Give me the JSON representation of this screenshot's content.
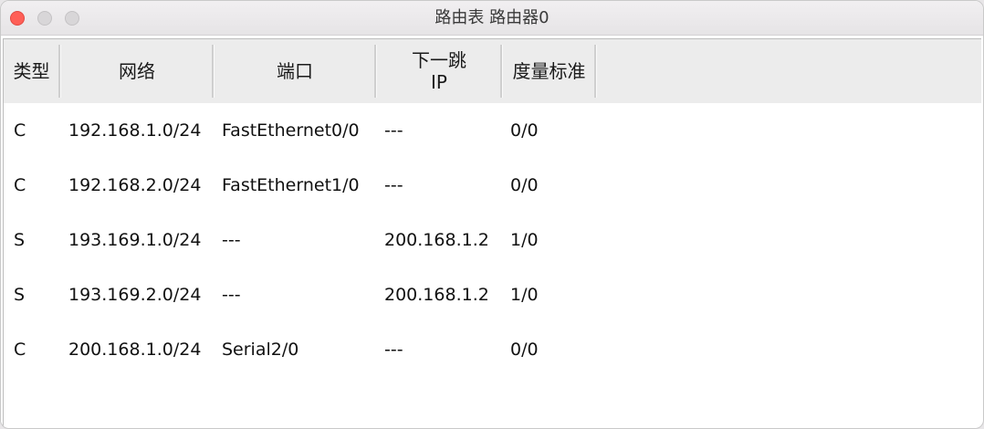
{
  "window": {
    "title": "路由表 路由器0"
  },
  "table": {
    "columns": [
      {
        "key": "type",
        "label": "类型"
      },
      {
        "key": "network",
        "label": "网络"
      },
      {
        "key": "port",
        "label": "端口"
      },
      {
        "key": "next_hop_line1",
        "label": "下一跳"
      },
      {
        "key": "next_hop_line2",
        "label": "IP"
      },
      {
        "key": "metric",
        "label": "度量标准"
      }
    ],
    "rows": [
      {
        "type": "C",
        "network": "192.168.1.0/24",
        "port": "FastEthernet0/0",
        "next_hop": "---",
        "metric": "0/0"
      },
      {
        "type": "C",
        "network": "192.168.2.0/24",
        "port": "FastEthernet1/0",
        "next_hop": "---",
        "metric": "0/0"
      },
      {
        "type": "S",
        "network": "193.169.1.0/24",
        "port": "---",
        "next_hop": "200.168.1.2",
        "metric": "1/0"
      },
      {
        "type": "S",
        "network": "193.169.2.0/24",
        "port": "---",
        "next_hop": "200.168.1.2",
        "metric": "1/0"
      },
      {
        "type": "C",
        "network": "200.168.1.0/24",
        "port": "Serial2/0",
        "next_hop": "---",
        "metric": "0/0"
      }
    ]
  },
  "icons": {
    "close": "close-icon",
    "minimize": "minimize-icon",
    "maximize": "maximize-icon"
  },
  "colors": {
    "close": "#ff5f57",
    "inactive_button": "#d8d6d8",
    "header_bg": "#ececec"
  }
}
